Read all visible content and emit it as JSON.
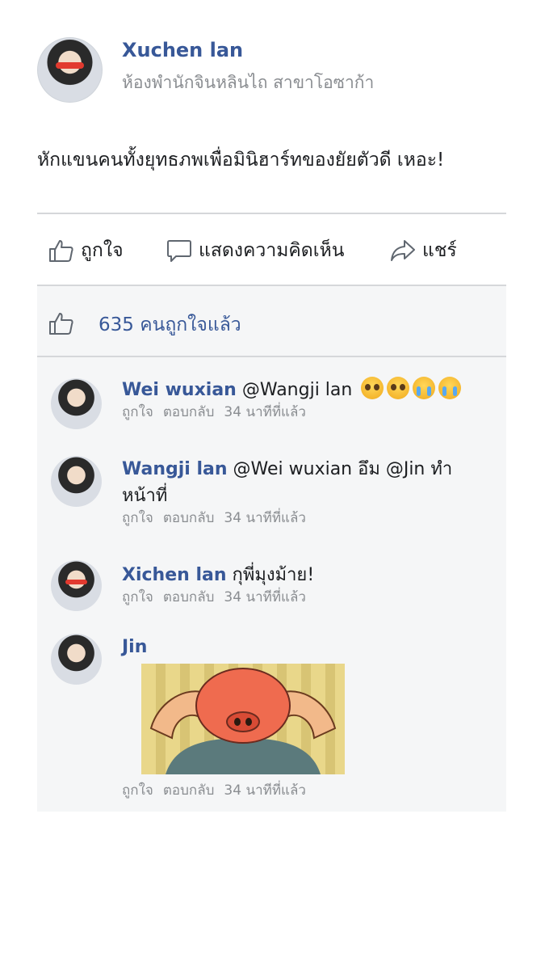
{
  "post": {
    "author": "Xuchen lan",
    "location": "ห้องพำนักจินหลินไถ สาขาโอซาก้า",
    "text": "หักแขนคนทั้งยุทธภพเพื่อมินิฮาร์ทของยัยตัวดี เหอะ!"
  },
  "actions": {
    "like": "ถูกใจ",
    "comment": "แสดงความคิดเห็น",
    "share": "แชร์"
  },
  "likes": {
    "count_text": "635 คนถูกใจแล้ว"
  },
  "comments": [
    {
      "name": "Wei wuxian",
      "text": "@Wangji lan",
      "emojis": [
        "pleading-face-emoji",
        "pleading-face-emoji",
        "loudly-crying-emoji",
        "loudly-crying-emoji"
      ],
      "like": "ถูกใจ",
      "reply": "ตอบกลับ",
      "time": "34 นาทีที่แล้ว"
    },
    {
      "name": "Wangji lan",
      "text": "@Wei wuxian อึม @Jin ทำหน้าที่",
      "like": "ถูกใจ",
      "reply": "ตอบกลับ",
      "time": "34 นาทีที่แล้ว"
    },
    {
      "name": "Xichen lan",
      "text": "กุพี่มุงม้าย!",
      "like": "ถูกใจ",
      "reply": "ตอบกลับ",
      "time": "34 นาทีที่แล้ว"
    },
    {
      "name": "Jin",
      "text": "",
      "attachment": "meme-image",
      "like": "ถูกใจ",
      "reply": "ตอบกลับ",
      "time": "34 นาทีที่แล้ว"
    }
  ],
  "colors": {
    "link_blue": "#385898",
    "meta_gray": "#8a8d91",
    "panel_bg": "#f5f6f7",
    "divider": "#d5d7da"
  }
}
